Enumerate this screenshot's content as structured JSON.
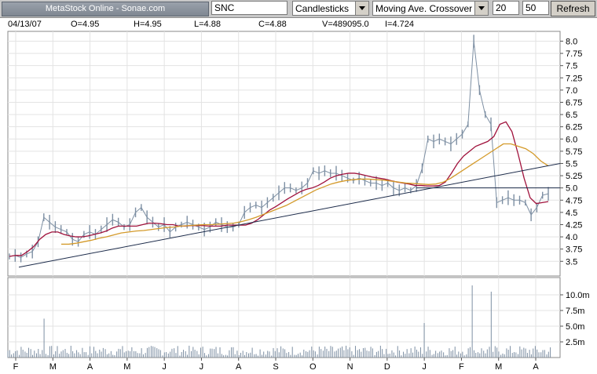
{
  "toolbar": {
    "title": "MetaStock Online - Sonae.com",
    "symbol": "SNC",
    "chart_style": "Candlesticks",
    "indicator": "Moving Ave. Crossover",
    "period_1": "20",
    "period_2": "50",
    "refresh_label": "Refresh"
  },
  "quote": {
    "date": "04/13/07",
    "open": "O=4.95",
    "high": "H=4.95",
    "low": "L=4.88",
    "close": "C=4.88",
    "volume": "V=489095.0",
    "indicator": "I=4.724"
  },
  "colors": {
    "price": "#7d8fa3",
    "ma_short": "#a0123c",
    "ma_long": "#d49a2a",
    "trendline": "#1c2b4a",
    "grid": "#e3e3e3",
    "frame": "#888888"
  },
  "chart_data": {
    "type": "line",
    "x_tick_labels": [
      "F",
      "M",
      "A",
      "M",
      "J",
      "J",
      "A",
      "S",
      "O",
      "N",
      "D",
      "J",
      "F",
      "M",
      "A"
    ],
    "price_axis": {
      "ylim": [
        3.2,
        8.2
      ],
      "ticks": [
        3.5,
        3.75,
        4.0,
        4.25,
        4.5,
        4.75,
        5.0,
        5.25,
        5.5,
        5.75,
        6.0,
        6.25,
        6.5,
        6.75,
        7.0,
        7.25,
        7.5,
        7.75,
        8.0
      ]
    },
    "volume_axis": {
      "ylim": [
        0,
        12
      ],
      "ticks": [
        2.5,
        5.0,
        7.5,
        10.0
      ],
      "tick_labels": [
        "2.5m",
        "5.0m",
        "7.5m",
        "10.0m"
      ]
    },
    "series": [
      {
        "key": "price",
        "values": [
          3.6,
          3.62,
          3.58,
          3.65,
          3.7,
          3.9,
          4.4,
          4.3,
          4.2,
          4.15,
          4.1,
          3.95,
          3.9,
          4.05,
          4.1,
          4.05,
          4.15,
          4.25,
          4.35,
          4.3,
          4.2,
          4.25,
          4.5,
          4.6,
          4.4,
          4.3,
          4.2,
          4.25,
          4.1,
          4.2,
          4.25,
          4.3,
          4.25,
          4.2,
          4.15,
          4.2,
          4.3,
          4.25,
          4.2,
          4.2,
          4.25,
          4.5,
          4.6,
          4.65,
          4.6,
          4.7,
          4.8,
          4.9,
          5.0,
          5.0,
          4.95,
          5.0,
          5.1,
          5.35,
          5.3,
          5.35,
          5.3,
          5.3,
          5.25,
          5.2,
          5.15,
          5.2,
          5.15,
          5.1,
          5.1,
          5.05,
          5.1,
          5.0,
          4.95,
          5.0,
          4.95,
          5.05,
          5.4,
          6.0,
          5.95,
          6.0,
          5.95,
          5.9,
          6.0,
          6.1,
          6.3,
          8.0,
          7.0,
          6.5,
          6.3,
          4.7,
          4.75,
          4.8,
          4.75,
          4.75,
          4.7,
          4.45,
          4.6,
          4.85,
          4.88
        ]
      },
      {
        "key": "ma_short",
        "values": [
          3.6,
          3.62,
          3.62,
          3.7,
          3.8,
          3.95,
          4.05,
          4.1,
          4.1,
          4.05,
          4.02,
          4.0,
          4.0,
          4.02,
          4.05,
          4.08,
          4.12,
          4.18,
          4.22,
          4.22,
          4.22,
          4.22,
          4.25,
          4.28,
          4.28,
          4.27,
          4.25,
          4.25,
          4.22,
          4.22,
          4.23,
          4.23,
          4.23,
          4.22,
          4.22,
          4.22,
          4.24,
          4.24,
          4.24,
          4.24,
          4.28,
          4.35,
          4.45,
          4.55,
          4.62,
          4.7,
          4.78,
          4.85,
          4.92,
          4.97,
          5.0,
          5.05,
          5.12,
          5.2,
          5.25,
          5.28,
          5.3,
          5.3,
          5.28,
          5.25,
          5.22,
          5.2,
          5.18,
          5.15,
          5.12,
          5.1,
          5.08,
          5.05,
          5.05,
          5.04,
          5.04,
          5.05,
          5.12,
          5.3,
          5.5,
          5.65,
          5.75,
          5.85,
          5.9,
          5.95,
          6.05,
          6.3,
          6.35,
          6.15,
          5.7,
          5.2,
          4.8,
          4.68,
          4.7,
          4.72
        ]
      },
      {
        "key": "ma_long",
        "values": [
          3.85,
          3.85,
          3.87,
          3.9,
          3.93,
          3.97,
          4.0,
          4.04,
          4.08,
          4.1,
          4.12,
          4.13,
          4.15,
          4.17,
          4.19,
          4.2,
          4.22,
          4.23,
          4.24,
          4.25,
          4.25,
          4.26,
          4.27,
          4.28,
          4.31,
          4.35,
          4.4,
          4.46,
          4.52,
          4.58,
          4.64,
          4.72,
          4.8,
          4.88,
          4.96,
          5.02,
          5.08,
          5.12,
          5.15,
          5.17,
          5.18,
          5.18,
          5.17,
          5.16,
          5.14,
          5.12,
          5.1,
          5.09,
          5.08,
          5.07,
          5.08,
          5.12,
          5.2,
          5.3,
          5.4,
          5.5,
          5.6,
          5.7,
          5.8,
          5.9,
          5.9,
          5.85,
          5.8,
          5.7,
          5.55,
          5.45
        ]
      }
    ],
    "horizontal_line": 5.0
  }
}
